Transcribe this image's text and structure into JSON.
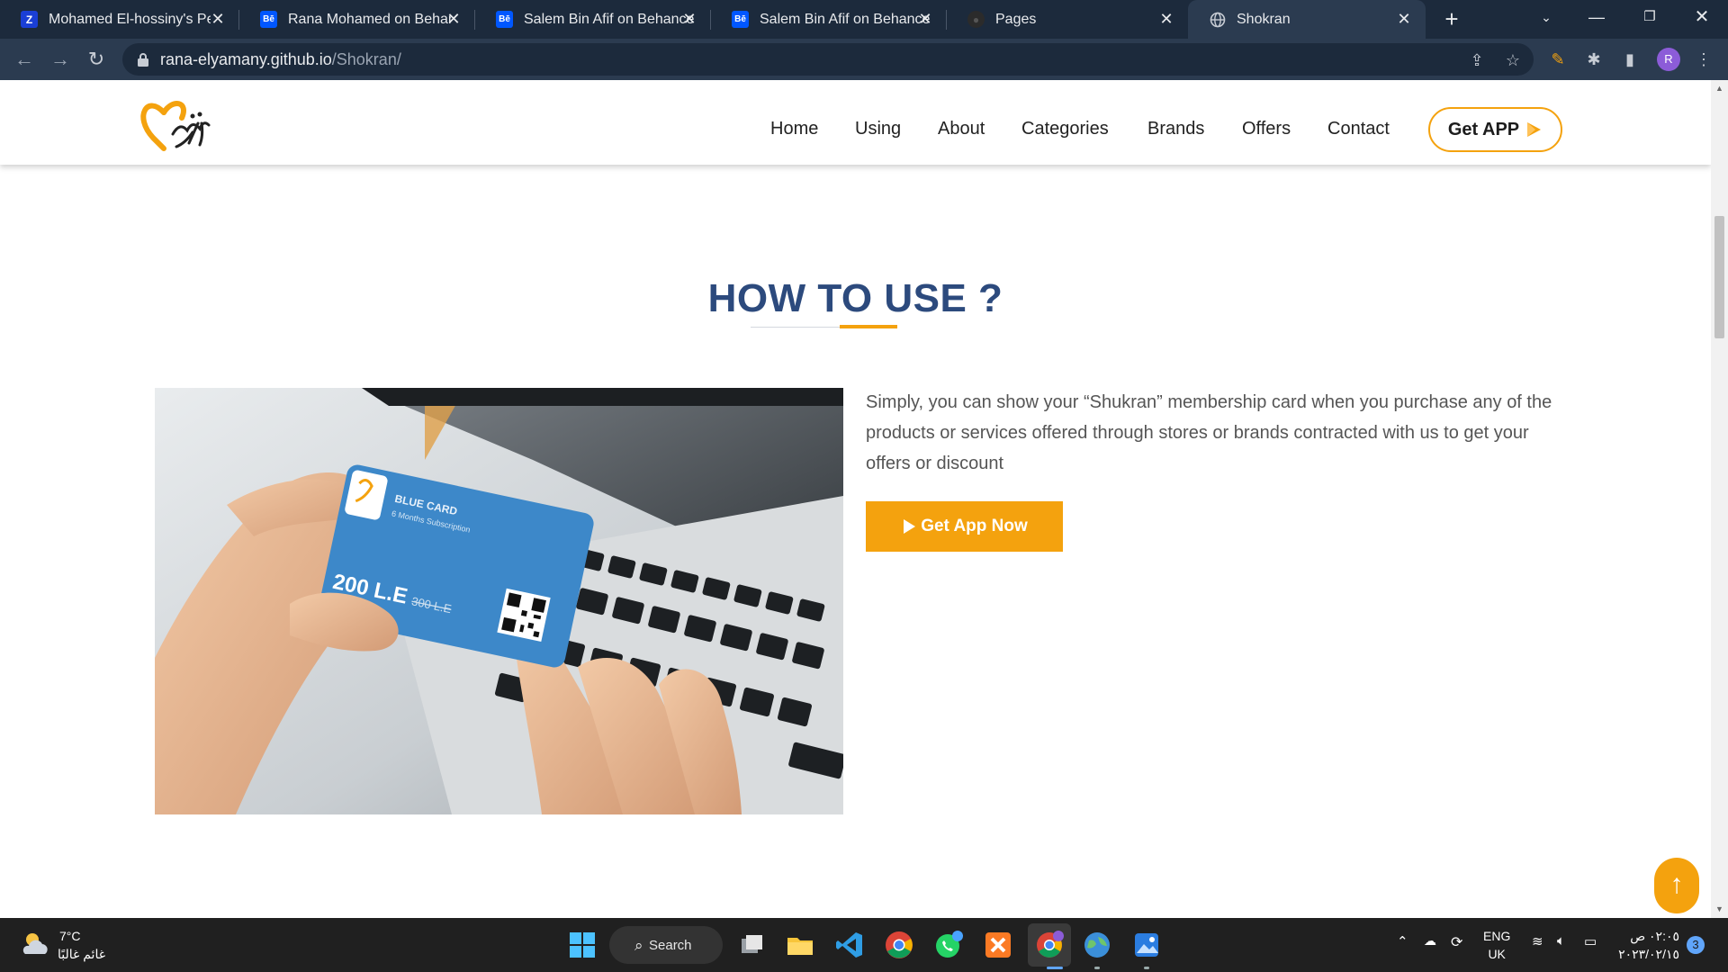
{
  "browser": {
    "tabs": [
      {
        "title": "Mohamed El-hossiny's Pers",
        "favicon": "Z",
        "favicon_color": "#1a3fd6"
      },
      {
        "title": "Rana Mohamed on Behanc",
        "favicon": "Bē",
        "favicon_color": "#0057ff"
      },
      {
        "title": "Salem Bin Afif on Behance",
        "favicon": "Bē",
        "favicon_color": "#0057ff"
      },
      {
        "title": "Salem Bin Afif on Behance",
        "favicon": "Bē",
        "favicon_color": "#0057ff"
      },
      {
        "title": "Pages",
        "favicon": "github-icon",
        "favicon_color": "#333"
      },
      {
        "title": "Shokran",
        "favicon": "globe-icon",
        "favicon_color": "#9aa4b2"
      }
    ],
    "url_host": "rana-elyamany.github.io",
    "url_path": "/Shokran/",
    "profile_initial": "R"
  },
  "site": {
    "nav": [
      "Home",
      "Using",
      "About",
      "Categories",
      "Brands",
      "Offers",
      "Contact"
    ],
    "get_app_label": "Get APP",
    "section_title": "HOW TO USE ?",
    "description": "Simply, you can show your “Shukran” membership card when you purchase any of the products or services offered through stores or brands contracted with us to get your offers or discount",
    "cta_label": "Get App Now",
    "card": {
      "name": "BLUE CARD",
      "subscription": "6 Months Subscription",
      "price": "200 L.E",
      "old_price": "300 L.E"
    },
    "accent_color": "#f4a20e",
    "title_color": "#2c4a7d"
  },
  "taskbar": {
    "temperature": "7°C",
    "condition": "غائم غالبًا",
    "search_label": "Search",
    "lang_line1": "ENG",
    "lang_line2": "UK",
    "time": "٠٢:٠٥ ص",
    "date": "٢٠٢٣/٠٢/١٥",
    "notifications": "3"
  }
}
